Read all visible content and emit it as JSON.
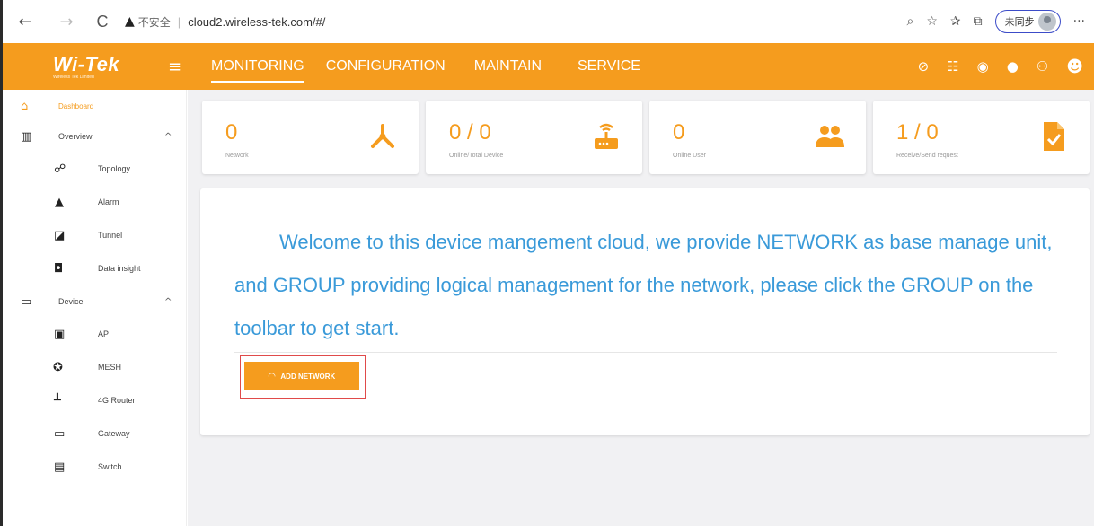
{
  "browser": {
    "back_glyph": "←",
    "forward_glyph": "→",
    "reload_glyph": "C",
    "security_label": "不安全",
    "url": "cloud2.wireless-tek.com/#/",
    "sync_label": "未同步",
    "more_glyph": "···"
  },
  "header": {
    "logo_text": "Wi-Tek",
    "logo_sub": "Wireless Tek Limited",
    "nav": [
      {
        "label": "MONITORING"
      },
      {
        "label": "CONFIGURATION"
      },
      {
        "label": "MAINTAIN"
      },
      {
        "label": "SERVICE"
      }
    ],
    "accent_color": "#f59c1e"
  },
  "sidebar": {
    "dashboard": "Dashboard",
    "overview": "Overview",
    "overview_items": [
      {
        "label": "Topology",
        "icon": "topology-icon"
      },
      {
        "label": "Alarm",
        "icon": "bell-icon"
      },
      {
        "label": "Tunnel",
        "icon": "tunnel-icon"
      },
      {
        "label": "Data insight",
        "icon": "data-insight-icon"
      }
    ],
    "device": "Device",
    "device_items": [
      {
        "label": "AP",
        "icon": "ap-icon"
      },
      {
        "label": "MESH",
        "icon": "mesh-icon"
      },
      {
        "label": "4G Router",
        "icon": "router-icon"
      },
      {
        "label": "Gateway",
        "icon": "gateway-icon"
      },
      {
        "label": "Switch",
        "icon": "switch-icon"
      }
    ]
  },
  "stats": [
    {
      "value": "0",
      "label": "Network",
      "icon": "network-icon"
    },
    {
      "value": "0 / 0",
      "label": "Online/Total Device",
      "icon": "router-device-icon"
    },
    {
      "value": "0",
      "label": "Online User",
      "icon": "users-icon"
    },
    {
      "value": "1 / 0",
      "label": "Receive/Send request",
      "icon": "document-check-icon"
    }
  ],
  "welcome": {
    "text": "Welcome to this device mangement cloud, we provide NETWORK as base manage unit, and GROUP providing logical management for the network, please click the GROUP on the toolbar to get start.",
    "add_network_label": "ADD NETWORK"
  }
}
